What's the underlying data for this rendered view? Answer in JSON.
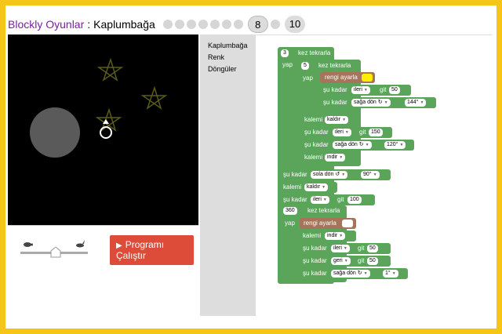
{
  "header": {
    "app_name": "Blockly Oyunlar",
    "separator": ":",
    "title": "Kaplumbağa",
    "levels": [
      "8",
      "10"
    ]
  },
  "toolbox": {
    "items": [
      "Kaplumbağa",
      "Renk",
      "Döngüler"
    ]
  },
  "controls": {
    "run_line1": "Programı",
    "run_line2": "Çalıştır",
    "play_icon": "▶"
  },
  "program": {
    "repeat_outer_count": "3",
    "repeat_inner_count": "5",
    "repeat_label": "kez tekrarla",
    "do_label": "yap",
    "set_color": "rengi ayarla",
    "move_prefix": "şu kadar",
    "forward": "ileri",
    "back": "geri",
    "go": "git",
    "turn_right": "sağa dön ↻",
    "turn_left": "sola dön ↺",
    "pen_up": "kaldır",
    "pen_down": "indir",
    "pen_label": "kalemi",
    "n50": "50",
    "n144": "144°",
    "n150": "150",
    "n120": "120°",
    "n90": "90°",
    "n100": "100",
    "n360": "360",
    "n1": "1°",
    "color_yellow": "#ffee00",
    "color_white": "#ffffff"
  }
}
